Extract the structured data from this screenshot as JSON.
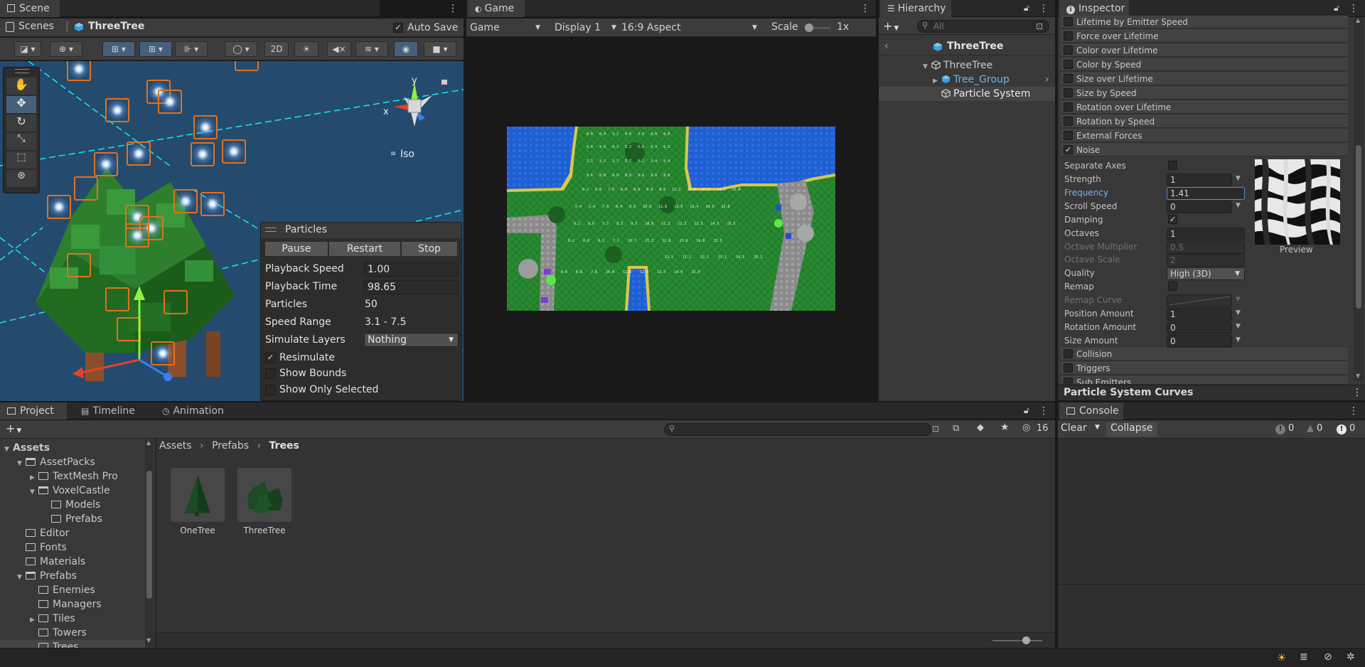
{
  "scene_panel": {
    "tab_label": "Scene",
    "scenes_label": "Scenes",
    "breadcrumb_object": "ThreeTree",
    "auto_save_label": "Auto Save",
    "auto_save_checked": true,
    "toolbar": {
      "mode_2d_label": "2D"
    },
    "gizmo": {
      "x_label": "x",
      "y_label": "y",
      "projection_label": "Iso"
    },
    "tools": [
      "view-hand-tool",
      "move-tool",
      "rotate-tool",
      "scale-tool",
      "rect-tool",
      "transform-tool"
    ],
    "particles_overlay": {
      "title": "Particles",
      "buttons": [
        "Pause",
        "Restart",
        "Stop"
      ],
      "rows": [
        {
          "label": "Playback Speed",
          "value": "1.00"
        },
        {
          "label": "Playback Time",
          "value": "98.65"
        },
        {
          "label": "Particles",
          "value": "50"
        },
        {
          "label": "Speed Range",
          "value": "3.1 - 7.5"
        },
        {
          "label": "Simulate Layers",
          "value": "Nothing"
        }
      ],
      "checkboxes": [
        {
          "label": "Resimulate",
          "checked": true
        },
        {
          "label": "Show Bounds",
          "checked": false
        },
        {
          "label": "Show Only Selected",
          "checked": false
        }
      ]
    }
  },
  "game_panel": {
    "tab_label": "Game",
    "game_dropdown": "Game",
    "display_dropdown": "Display 1",
    "aspect_dropdown": "16:9 Aspect",
    "scale_label": "Scale",
    "scale_value": "1x"
  },
  "hierarchy_panel": {
    "tab_label": "Hierarchy",
    "search_placeholder": "All",
    "scene_root": "ThreeTree",
    "items": [
      {
        "label": "ThreeTree",
        "depth": 1
      },
      {
        "label": "Tree_Group",
        "depth": 2
      },
      {
        "label": "Particle System",
        "depth": 2
      }
    ]
  },
  "inspector_panel": {
    "tab_label": "Inspector",
    "modules_top": [
      {
        "label": "Lifetime by Emitter Speed",
        "enabled": false
      },
      {
        "label": "Force over Lifetime",
        "enabled": false
      },
      {
        "label": "Color over Lifetime",
        "enabled": false
      },
      {
        "label": "Color by Speed",
        "enabled": false
      },
      {
        "label": "Size over Lifetime",
        "enabled": false
      },
      {
        "label": "Size by Speed",
        "enabled": false
      },
      {
        "label": "Rotation over Lifetime",
        "enabled": false
      },
      {
        "label": "Rotation by Speed",
        "enabled": false
      },
      {
        "label": "External Forces",
        "enabled": false
      },
      {
        "label": "Noise",
        "enabled": true
      }
    ],
    "noise": {
      "separate_axes_label": "Separate Axes",
      "strength_label": "Strength",
      "strength_value": "1",
      "frequency_label": "Frequency",
      "frequency_value": "1.41",
      "scroll_speed_label": "Scroll Speed",
      "scroll_speed_value": "0",
      "damping_label": "Damping",
      "octaves_label": "Octaves",
      "octaves_value": "1",
      "octave_multiplier_label": "Octave Multiplier",
      "octave_multiplier_value": "0.5",
      "octave_scale_label": "Octave Scale",
      "octave_scale_value": "2",
      "quality_label": "Quality",
      "quality_value": "High (3D)",
      "remap_label": "Remap",
      "remap_curve_label": "Remap Curve",
      "position_amount_label": "Position Amount",
      "position_amount_value": "1",
      "rotation_amount_label": "Rotation Amount",
      "rotation_amount_value": "0",
      "size_amount_label": "Size Amount",
      "size_amount_value": "0",
      "preview_label": "Preview"
    },
    "modules_bottom": [
      {
        "label": "Collision",
        "enabled": false
      },
      {
        "label": "Triggers",
        "enabled": false
      },
      {
        "label": "Sub Emitters",
        "enabled": false
      }
    ],
    "curves_title": "Particle System Curves"
  },
  "project_panel": {
    "tabs": [
      "Project",
      "Timeline",
      "Animation"
    ],
    "hidden_count": "16",
    "tree": [
      {
        "label": "Assets",
        "depth": 0,
        "bold": true
      },
      {
        "label": "AssetPacks",
        "depth": 1
      },
      {
        "label": "TextMesh Pro",
        "depth": 2
      },
      {
        "label": "VoxelCastle",
        "depth": 2
      },
      {
        "label": "Models",
        "depth": 3
      },
      {
        "label": "Prefabs",
        "depth": 3
      },
      {
        "label": "Editor",
        "depth": 1
      },
      {
        "label": "Fonts",
        "depth": 1
      },
      {
        "label": "Materials",
        "depth": 1
      },
      {
        "label": "Prefabs",
        "depth": 1
      },
      {
        "label": "Enemies",
        "depth": 2
      },
      {
        "label": "Managers",
        "depth": 2
      },
      {
        "label": "Tiles",
        "depth": 2
      },
      {
        "label": "Towers",
        "depth": 2
      },
      {
        "label": "Trees",
        "depth": 2
      }
    ],
    "breadcrumb": [
      "Assets",
      "Prefabs",
      "Trees"
    ],
    "assets": [
      {
        "label": "OneTree"
      },
      {
        "label": "ThreeTree"
      }
    ]
  },
  "console_panel": {
    "tab_label": "Console",
    "clear_label": "Clear",
    "collapse_label": "Collapse",
    "log_count": "0",
    "warn_count": "0",
    "error_count": "0"
  },
  "game_view_numbers": {
    "row1": [
      "0.0",
      "0.4",
      "3.2",
      "0.0",
      "3.0",
      "0.0",
      "0.0"
    ],
    "row2": [
      "6.4",
      "4.6",
      "4.2",
      "5.2",
      "5.6",
      "6.4",
      "6.2"
    ],
    "row3": [
      "3.2",
      "3.2",
      "3.7",
      "3.7",
      "5.2",
      "3.4",
      "5.4"
    ],
    "row4": [
      "8.6",
      "8.8",
      "8.8",
      "8.8",
      "8.8",
      "8.8",
      "8.8"
    ],
    "row5": [
      "8.2",
      "6.8",
      "7.0",
      "8.0",
      "8.6",
      "8.8",
      "8.6",
      "11.3",
      "13.4",
      "13.5",
      "14.8",
      "15.0"
    ],
    "row6": [
      "5.4",
      "3.4",
      "7.4",
      "8.4",
      "8.6",
      "10.6",
      "11.6",
      "13.0",
      "13.4",
      "14.0",
      "15.0"
    ],
    "row7": [
      "8.2",
      "8.8",
      "7.3",
      "8.3",
      "9.3",
      "10.8",
      "11.3",
      "12.3",
      "13.3",
      "14.5",
      "15.5"
    ],
    "row8": [
      "8.2",
      "8.8",
      "8.1",
      "7.1",
      "10.7",
      "11.3",
      "12.8",
      "13.8",
      "14.8",
      "15.5"
    ],
    "row9": [
      "13.1",
      "11.1",
      "13.1",
      "15.1",
      "14.1",
      "15.1"
    ],
    "row10": [
      "8.0",
      "8.8",
      "7.8",
      "10.0",
      "11.0",
      "12.0",
      "13.5",
      "14.0",
      "15.0"
    ]
  }
}
